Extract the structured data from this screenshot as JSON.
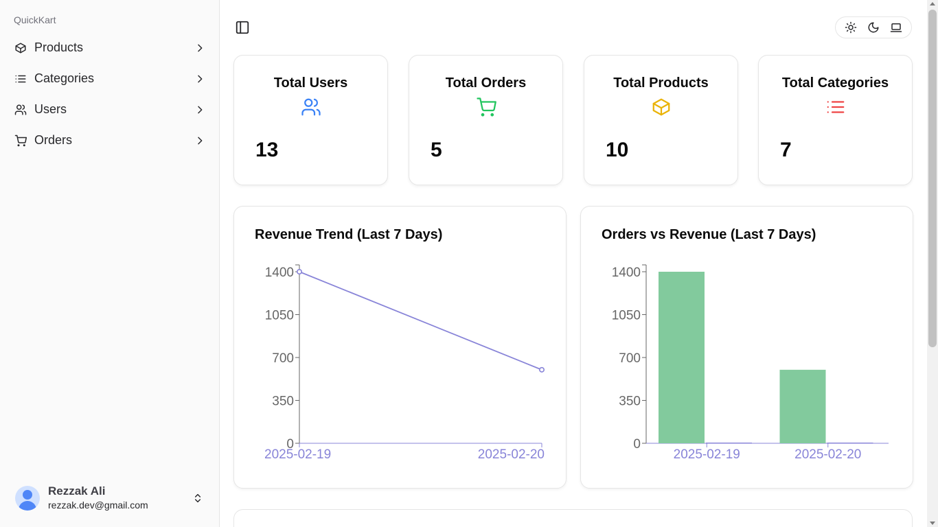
{
  "sidebar": {
    "brand": "QuickKart",
    "items": [
      {
        "label": "Products",
        "icon": "box-icon"
      },
      {
        "label": "Categories",
        "icon": "list-icon"
      },
      {
        "label": "Users",
        "icon": "users-icon"
      },
      {
        "label": "Orders",
        "icon": "cart-icon"
      }
    ],
    "user": {
      "name": "Rezzak Ali",
      "email": "rezzak.dev@gmail.com"
    }
  },
  "header": {
    "toggle_icon": "sidebar-toggle-icon",
    "theme_icons": [
      "sun-icon",
      "moon-icon",
      "laptop-icon"
    ]
  },
  "stats": [
    {
      "title": "Total Users",
      "value": "13",
      "icon": "users-icon",
      "color": "#3b82f6"
    },
    {
      "title": "Total Orders",
      "value": "5",
      "icon": "cart-icon",
      "color": "#22c55e"
    },
    {
      "title": "Total Products",
      "value": "10",
      "icon": "box-icon",
      "color": "#eab308"
    },
    {
      "title": "Total Categories",
      "value": "7",
      "icon": "list-icon",
      "color": "#ef4444"
    }
  ],
  "charts": {
    "revenue_title": "Revenue Trend (Last 7 Days)",
    "orders_title": "Orders vs Revenue (Last 7 Days)"
  },
  "chart_data": [
    {
      "type": "line",
      "title": "Revenue Trend (Last 7 Days)",
      "x": [
        "2025-02-19",
        "2025-02-20"
      ],
      "series": [
        {
          "values": [
            1400,
            600
          ],
          "color": "#8884d8"
        }
      ],
      "yticks": [
        0,
        350,
        700,
        1050,
        1400
      ],
      "ylim": [
        0,
        1400
      ],
      "grid": false
    },
    {
      "type": "bar",
      "title": "Orders vs Revenue (Last 7 Days)",
      "categories": [
        "2025-02-19",
        "2025-02-20"
      ],
      "series": [
        {
          "values": [
            1400,
            600
          ],
          "color": "#82ca9d"
        },
        {
          "values": [
            3,
            2
          ],
          "color": "#8884d8"
        }
      ],
      "yticks": [
        0,
        350,
        700,
        1050,
        1400
      ],
      "ylim": [
        0,
        1400
      ],
      "grid": false
    }
  ]
}
